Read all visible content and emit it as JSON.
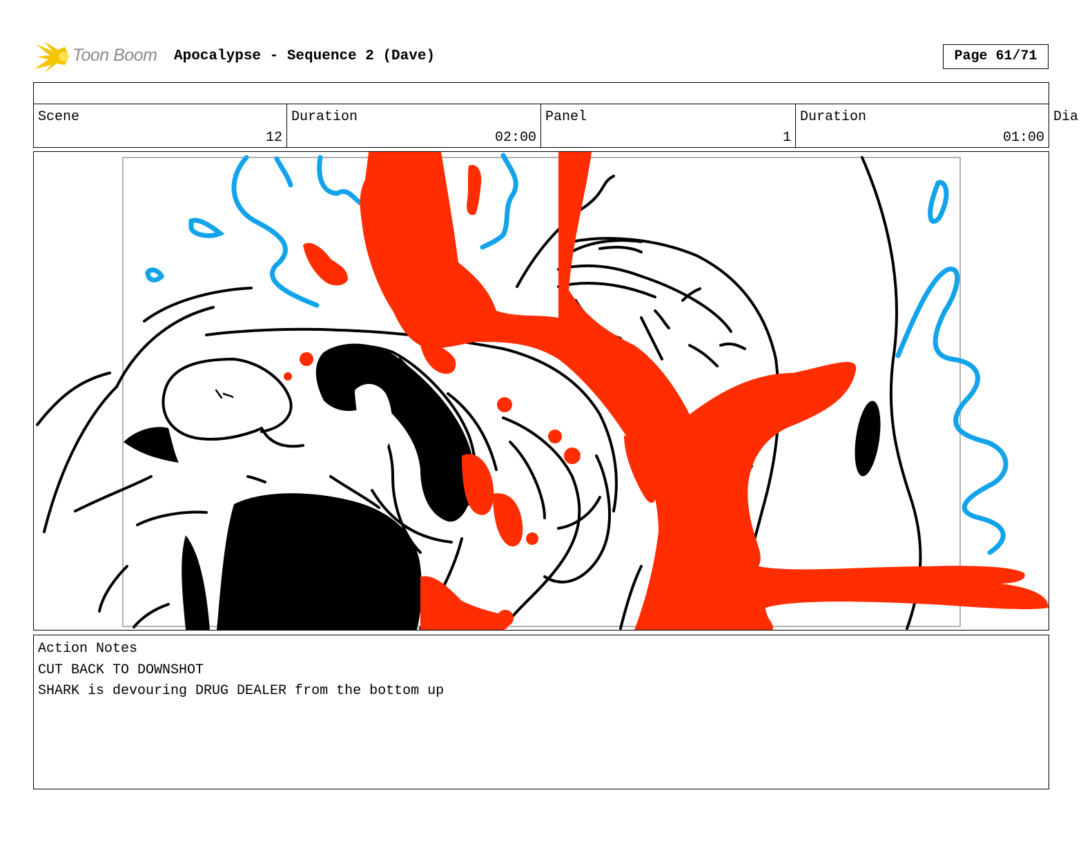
{
  "header": {
    "logo_text": "Toon Boom",
    "title": "Apocalypse - Sequence 2 (Dave)",
    "page": "Page 61/71"
  },
  "info": {
    "scene_label": "Scene",
    "scene_value": "12",
    "scene_duration_label": "Duration",
    "scene_duration_value": "02:00",
    "panel_label": "Panel",
    "panel_value": "1",
    "panel_duration_label": "Duration",
    "panel_duration_value": "01:00",
    "dialog_label_partial": "Dia"
  },
  "notes": {
    "label": "Action Notes",
    "lines": [
      "CUT BACK TO DOWNSHOT",
      "SHARK is devouring DRUG DEALER from the bottom up"
    ]
  },
  "colors": {
    "blood": "#ff2d00",
    "water": "#12a3ea",
    "ink": "#000000",
    "logo_star": "#f5c400"
  }
}
